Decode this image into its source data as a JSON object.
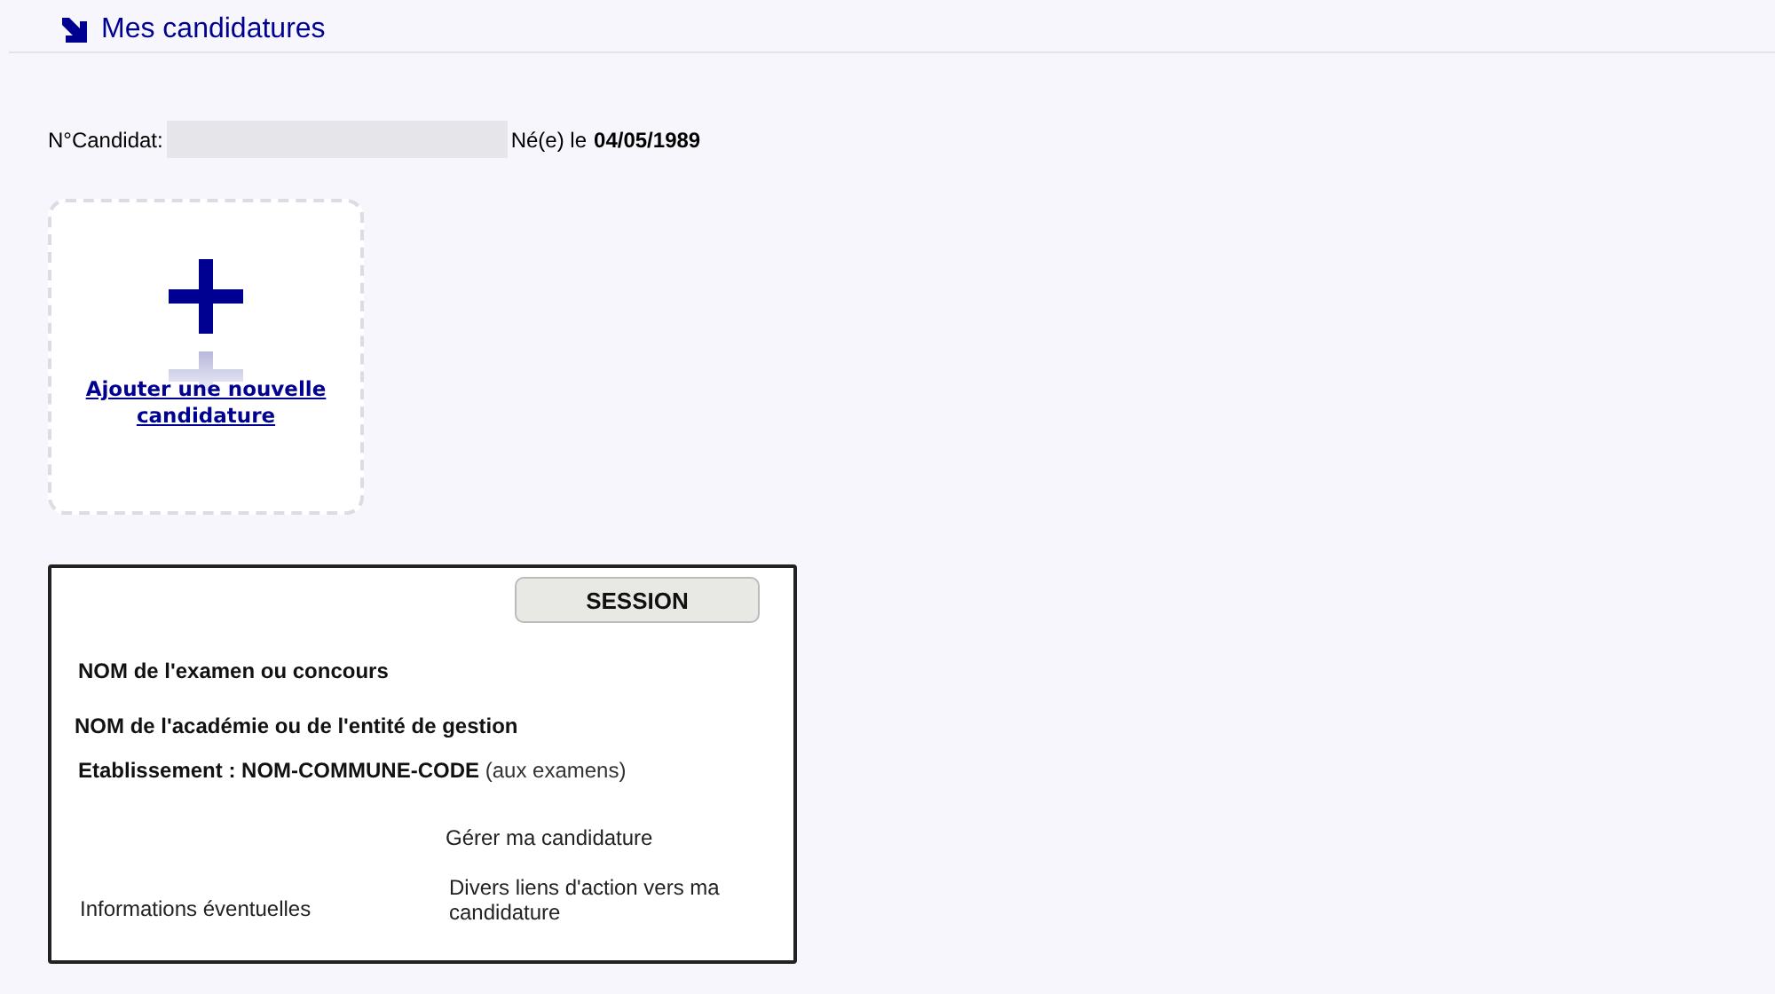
{
  "header": {
    "title": "Mes candidatures"
  },
  "candidate": {
    "number_label": "N°Candidat:",
    "birth_label": "Né(e) le",
    "birth_date": "04/05/1989"
  },
  "add_card": {
    "link": "Ajouter une nouvelle candidature"
  },
  "example_card": {
    "session": "SESSION",
    "exam": "NOM de l'examen ou concours",
    "academy": "NOM de l'académie ou de l'entité de gestion",
    "establishment": "Etablissement : NOM-COMMUNE-CODE",
    "establishment_note": "(aux examens)",
    "manage": "Gérer ma candidature",
    "info": "Informations éventuelles",
    "links": "Divers liens d'action vers ma candidature"
  }
}
